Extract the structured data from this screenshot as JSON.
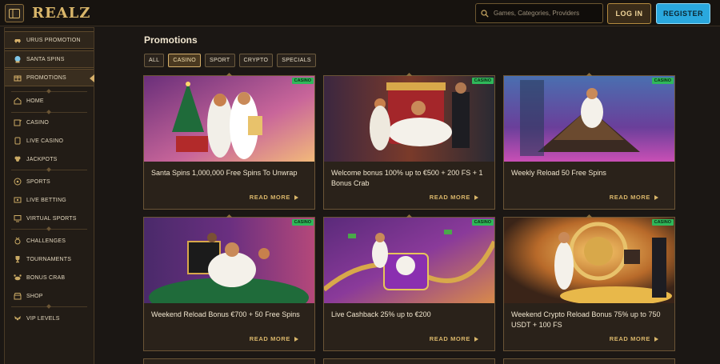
{
  "header": {
    "logo": "REALZ",
    "search_placeholder": "Games, Categories, Providers",
    "login_label": "LOG IN",
    "register_label": "REGISTER"
  },
  "sidebar": {
    "promos": [
      {
        "label": "URUS PROMOTION",
        "icon": "car-icon"
      },
      {
        "label": "SANTA SPINS",
        "icon": "snow-globe-icon"
      },
      {
        "label": "PROMOTIONS",
        "icon": "gift-icon"
      }
    ],
    "items": [
      {
        "label": "HOME",
        "icon": "home-icon"
      },
      {
        "label": "CASINO",
        "icon": "slot-icon"
      },
      {
        "label": "LIVE CASINO",
        "icon": "cards-icon"
      },
      {
        "label": "JACKPOTS",
        "icon": "clover-icon"
      },
      {
        "label": "SPORTS",
        "icon": "ball-icon"
      },
      {
        "label": "LIVE BETTING",
        "icon": "live-bet-icon"
      },
      {
        "label": "VIRTUAL SPORTS",
        "icon": "screen-icon"
      },
      {
        "label": "CHALLENGES",
        "icon": "medal-icon"
      },
      {
        "label": "TOURNAMENTS",
        "icon": "trophy-icon"
      },
      {
        "label": "BONUS CRAB",
        "icon": "crab-icon"
      },
      {
        "label": "SHOP",
        "icon": "shop-icon"
      },
      {
        "label": "VIP LEVELS",
        "icon": "wings-icon"
      }
    ]
  },
  "main": {
    "title": "Promotions",
    "tabs": [
      {
        "label": "ALL",
        "selected": false
      },
      {
        "label": "CASINO",
        "selected": true
      },
      {
        "label": "SPORT",
        "selected": false
      },
      {
        "label": "CRYPTO",
        "selected": false
      },
      {
        "label": "SPECIALS",
        "selected": false
      }
    ],
    "cards": [
      {
        "badge": "CASINO",
        "title": "Santa Spins 1,000,000 Free Spins To Unwrap",
        "cta": "READ MORE"
      },
      {
        "badge": "CASINO",
        "title": "Welcome bonus 100% up to €500 + 200 FS + 1 Bonus Crab",
        "cta": "READ MORE"
      },
      {
        "badge": "CASINO",
        "title": "Weekly Reload 50 Free Spins",
        "cta": "READ MORE"
      },
      {
        "badge": "CASINO",
        "title": "Weekend Reload Bonus €700 + 50 Free Spins",
        "cta": "READ MORE"
      },
      {
        "badge": "CASINO",
        "title": "Live Cashback 25% up to €200",
        "cta": "READ MORE"
      },
      {
        "badge": "CASINO",
        "title": "Weekend Crypto Reload Bonus 75% up to 750 USDT + 100 FS",
        "cta": "READ MORE"
      }
    ]
  },
  "colors": {
    "background": "#1b1714",
    "gold": "#d9b66a",
    "register": "#2aa8de",
    "badge": "#2fb85a"
  }
}
